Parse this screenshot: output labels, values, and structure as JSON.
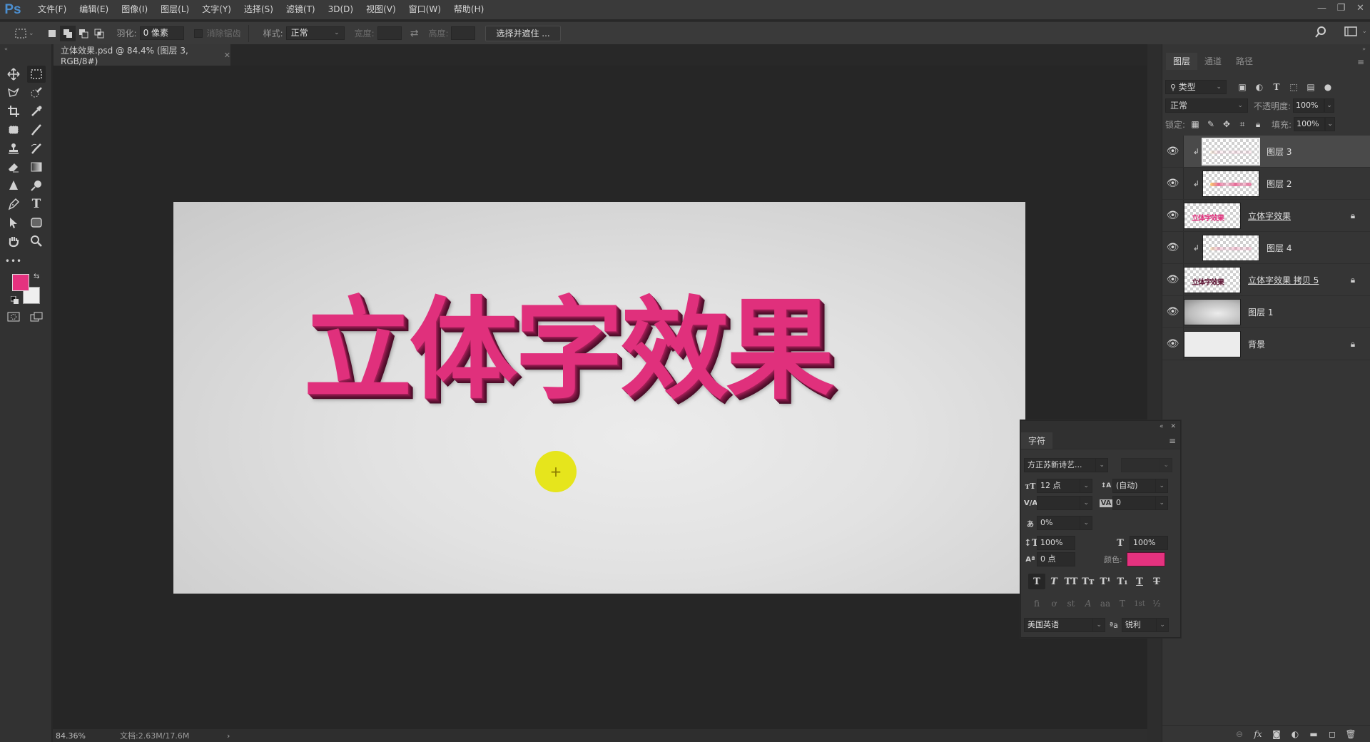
{
  "app": {
    "logo": "Ps"
  },
  "menu": [
    "文件(F)",
    "编辑(E)",
    "图像(I)",
    "图层(L)",
    "文字(Y)",
    "选择(S)",
    "滤镜(T)",
    "3D(D)",
    "视图(V)",
    "窗口(W)",
    "帮助(H)"
  ],
  "window_controls": {
    "minimize": "—",
    "restore": "❐",
    "close": "✕"
  },
  "options_bar": {
    "feather_label": "羽化:",
    "feather_value": "0 像素",
    "antialias_label": "消除锯齿",
    "style_label": "样式:",
    "style_value": "正常",
    "width_label": "宽度:",
    "width_value": "",
    "height_label": "高度:",
    "height_value": "",
    "select_mask_button": "选择并遮住 ..."
  },
  "document": {
    "tab_title": "立体效果.psd @ 84.4% (图层 3, RGB/8#)",
    "close": "✕",
    "canvas_text": "立体字效果",
    "text_color": "#e0307c"
  },
  "status_bar": {
    "zoom": "84.36%",
    "doc_info": "文档:2.63M/17.6M",
    "arrow": "›"
  },
  "tools": {
    "foreground_color": "#e5327f",
    "background_color": "#efefef",
    "more": "•••"
  },
  "layers_panel": {
    "tabs": [
      {
        "label": "图层",
        "active": true
      },
      {
        "label": "通道",
        "active": false
      },
      {
        "label": "路径",
        "active": false
      }
    ],
    "filter_type": "类型",
    "blend_mode": "正常",
    "opacity_label": "不透明度:",
    "opacity": "100%",
    "lock_label": "锁定:",
    "fill_label": "填充:",
    "fill": "100%",
    "layers": [
      {
        "name": "图层 3",
        "visible": true,
        "clipped": true,
        "selected": true,
        "locked": false,
        "thumb": "faint"
      },
      {
        "name": "图层 2",
        "visible": true,
        "clipped": true,
        "selected": false,
        "locked": false,
        "thumb": "dots"
      },
      {
        "name": "立体字效果",
        "visible": true,
        "clipped": false,
        "selected": false,
        "locked": true,
        "thumb": "text-pink",
        "thumb_text": "立体字效果"
      },
      {
        "name": "图层 4",
        "visible": true,
        "clipped": true,
        "selected": false,
        "locked": false,
        "thumb": "dots-faint"
      },
      {
        "name": "立体字效果 拷贝 5",
        "visible": true,
        "clipped": false,
        "selected": false,
        "locked": true,
        "thumb": "text-dark",
        "thumb_text": "立体字效果"
      },
      {
        "name": "图层 1",
        "visible": true,
        "clipped": false,
        "selected": false,
        "locked": false,
        "thumb": "gradient"
      },
      {
        "name": "背景",
        "visible": true,
        "clipped": false,
        "selected": false,
        "locked": true,
        "thumb": "plain"
      }
    ]
  },
  "character_panel": {
    "tab": "字符",
    "font_family": "方正苏新诗艺...",
    "font_style": "",
    "font_size": "12 点",
    "leading": "(自动)",
    "kerning": "",
    "tracking": "0",
    "tsume": "0%",
    "vertical_scale": "100%",
    "horizontal_scale": "100%",
    "baseline_shift": "0 点",
    "color_label": "颜色:",
    "color": "#e5327f",
    "style_buttons": [
      "T",
      "T",
      "TT",
      "Tт",
      "T¹",
      "T₁",
      "T",
      "T"
    ],
    "opentype_buttons": [
      "fi",
      "ơ",
      "st",
      "A",
      "aa",
      "T",
      "1st",
      "½"
    ],
    "language": "美国英语",
    "aa_label": "ªa",
    "antialias": "锐利"
  }
}
